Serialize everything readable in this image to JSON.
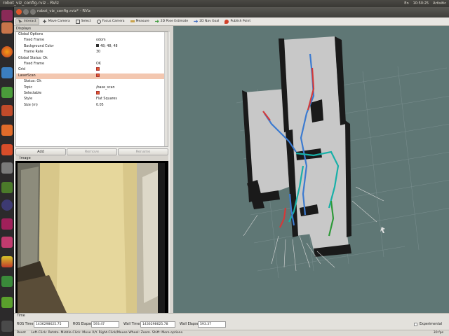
{
  "topbar": {
    "title": "robot_viz_config.rviz - RViz",
    "tray": [
      "En",
      "10:50:25",
      "Artisitic"
    ]
  },
  "window": {
    "title": "robot_viz_config.rviz* - RViz"
  },
  "toolbar": {
    "tools": [
      {
        "label": "Interact",
        "icon": "cursor-icon",
        "active": true
      },
      {
        "label": "Move Camera",
        "icon": "move-icon"
      },
      {
        "label": "Select",
        "icon": "select-icon"
      },
      {
        "label": "Focus Camera",
        "icon": "focus-icon"
      },
      {
        "label": "Measure",
        "icon": "ruler-icon"
      },
      {
        "label": "2D Pose Estimate",
        "icon": "pose-arrow-icon"
      },
      {
        "label": "2D Nav Goal",
        "icon": "goal-arrow-icon"
      },
      {
        "label": "Publish Point",
        "icon": "pin-icon"
      }
    ]
  },
  "displays": {
    "header": "Displays",
    "rows": [
      {
        "indent": 0,
        "key": "Global Options",
        "value": ""
      },
      {
        "indent": 1,
        "key": "Fixed Frame",
        "value": "odom"
      },
      {
        "indent": 1,
        "key": "Background Color",
        "value": "48; 48; 48",
        "swatch": true
      },
      {
        "indent": 1,
        "key": "Frame Rate",
        "value": "30"
      },
      {
        "indent": 0,
        "key": "Global Status: Ok",
        "value": ""
      },
      {
        "indent": 1,
        "key": "Fixed Frame",
        "value": "OK"
      },
      {
        "indent": 0,
        "key": "Grid",
        "value": "",
        "check": true
      },
      {
        "indent": 0,
        "key": "LaserScan",
        "value": "",
        "check": true,
        "selected": true
      },
      {
        "indent": 1,
        "key": "Status: Ok",
        "value": ""
      },
      {
        "indent": 1,
        "key": "Topic",
        "value": "/base_scan"
      },
      {
        "indent": 1,
        "key": "Selectable",
        "value": "",
        "check": true
      },
      {
        "indent": 1,
        "key": "Style",
        "value": "Flat Squares"
      },
      {
        "indent": 1,
        "key": "Size (m)",
        "value": "0.05"
      }
    ],
    "buttons": {
      "add": "Add",
      "remove": "Remove",
      "rename": "Rename"
    }
  },
  "image_panel": {
    "header": "Image"
  },
  "time": {
    "header": "Time",
    "ros_time_label": "ROS Time:",
    "ros_time": "1436298625.75",
    "ros_elapsed_label": "ROS Elapsed:",
    "ros_elapsed": "593.47",
    "wall_time_label": "Wall Time:",
    "wall_time": "1436298625.78",
    "wall_elapsed_label": "Wall Elapsed:",
    "wall_elapsed": "593.37",
    "experimental": "Experimental"
  },
  "status": {
    "reset": "Reset",
    "hint": "Left-Click: Rotate. Middle-Click: Move X/Y. Right-Click/Mouse Wheel: Zoom. Shift: More options.",
    "fps": "30 fps"
  },
  "colors": {
    "viewport_bg": "#5f7775",
    "selected_row": "#f3c7b0",
    "launcher_bg": "#2c2a2b"
  }
}
